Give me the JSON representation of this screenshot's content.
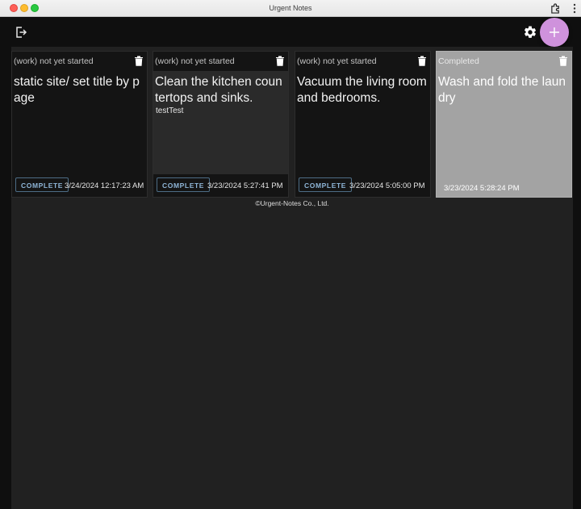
{
  "window": {
    "title": "Urgent Notes"
  },
  "toolbar": {
    "add_label": "+"
  },
  "notes": [
    {
      "status": "(work) not yet started",
      "title": "static site/ set title by page",
      "description": "",
      "complete_label": "COMPLETE",
      "date": "3/24/2024 12:17:23 AM"
    },
    {
      "status": "(work) not yet started",
      "title": "Clean the kitchen countertops and sinks.",
      "description": "testTest",
      "complete_label": "COMPLETE",
      "date": "3/23/2024 5:27:41 PM"
    },
    {
      "status": "(work) not yet started",
      "title": "Vacuum the living room and bedrooms.",
      "description": "",
      "complete_label": "COMPLETE",
      "date": "3/23/2024 5:05:00 PM"
    },
    {
      "status": "Completed",
      "title": "Wash and fold the laundry",
      "description": "",
      "date": "3/23/2024 5:28:24 PM"
    }
  ],
  "footer": {
    "copyright": "©Urgent-Notes Co., Ltd."
  },
  "colors": {
    "accent": "#cf92dc",
    "completed_card": "#a3a3a3",
    "button_outline": "#4d6d86"
  },
  "icons": [
    "logout-icon",
    "gear-icon",
    "plus-icon",
    "trash-icon",
    "extension-icon",
    "more-vertical-icon"
  ]
}
